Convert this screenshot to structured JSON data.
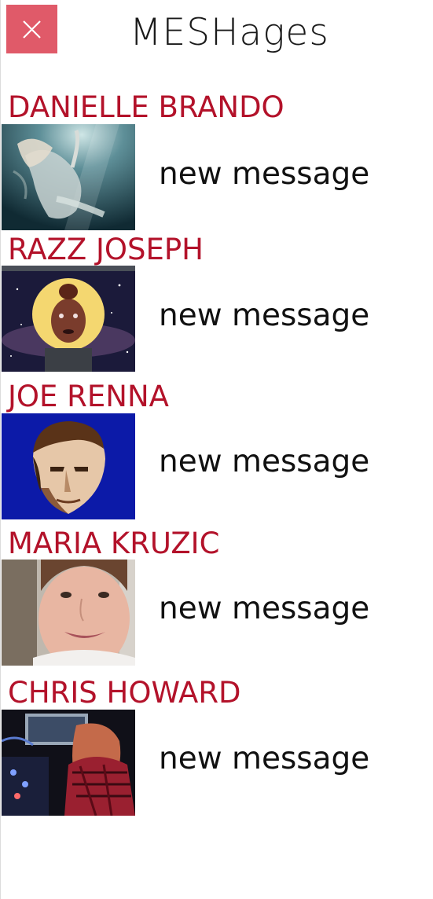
{
  "app": {
    "title": "MESHages",
    "close_icon": "close-icon",
    "accent_color": "#e05a69",
    "name_color": "#b3122a"
  },
  "contacts": [
    {
      "name": "DANIELLE BRANDO",
      "preview": "new message",
      "avatar": "underwater-portrait"
    },
    {
      "name": "RAZZ JOSEPH",
      "preview": "new message",
      "avatar": "space-portrait"
    },
    {
      "name": "JOE RENNA",
      "preview": "new message",
      "avatar": "posterized-portrait"
    },
    {
      "name": "MARIA KRUZIC",
      "preview": "new message",
      "avatar": "selfie-portrait"
    },
    {
      "name": "CHRIS HOWARD",
      "preview": "new message",
      "avatar": "studio-portrait"
    }
  ]
}
